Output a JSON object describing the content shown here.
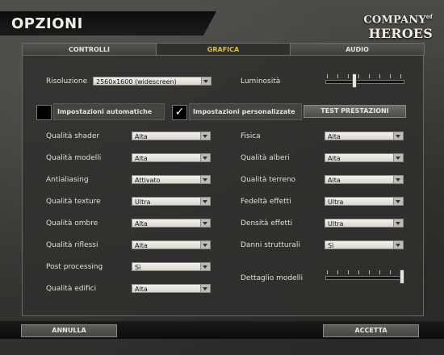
{
  "header": {
    "title": "OPZIONI",
    "logo_top": "COMPANY",
    "logo_of": "of",
    "logo_bottom": "HEROES"
  },
  "tabs": [
    {
      "label": "CONTROLLI",
      "active": false
    },
    {
      "label": "GRAFICA",
      "active": true
    },
    {
      "label": "AUDIO",
      "active": false
    }
  ],
  "resolution": {
    "label": "Risoluzione",
    "value": "2560x1600 (widescreen)"
  },
  "brightness": {
    "label": "Luminosità",
    "level_fraction": 0.35
  },
  "presets": {
    "auto": {
      "label": "Impostazioni automatiche",
      "checked": false
    },
    "custom": {
      "label": "Impostazioni personalizzate",
      "checked": true,
      "checkmark": "✓"
    },
    "test_button": "TEST PRESTAZIONI"
  },
  "left_settings": [
    {
      "label": "Qualità shader",
      "value": "Alta"
    },
    {
      "label": "Qualità modelli",
      "value": "Alta"
    },
    {
      "label": "Antialiasing",
      "value": "Attivato"
    },
    {
      "label": "Qualità texture",
      "value": "Ultra"
    },
    {
      "label": "Qualità ombre",
      "value": "Alta"
    },
    {
      "label": "Qualità riflessi",
      "value": "Alta"
    },
    {
      "label": "Post processing",
      "value": "Sì"
    },
    {
      "label": "Qualità edifici",
      "value": "Alta"
    }
  ],
  "right_settings": [
    {
      "label": "Fisica",
      "value": "Alta"
    },
    {
      "label": "Qualità alberi",
      "value": "Alta"
    },
    {
      "label": "Qualità terreno",
      "value": "Alta"
    },
    {
      "label": "Fedeltà effetti",
      "value": "Ultra"
    },
    {
      "label": "Densità effetti",
      "value": "Ultra"
    },
    {
      "label": "Danni strutturali",
      "value": "Sì"
    }
  ],
  "model_detail": {
    "label": "Dettaglio modelli",
    "level_fraction": 1.0
  },
  "footer": {
    "cancel": "ANNULLA",
    "accept": "ACCETTA"
  }
}
